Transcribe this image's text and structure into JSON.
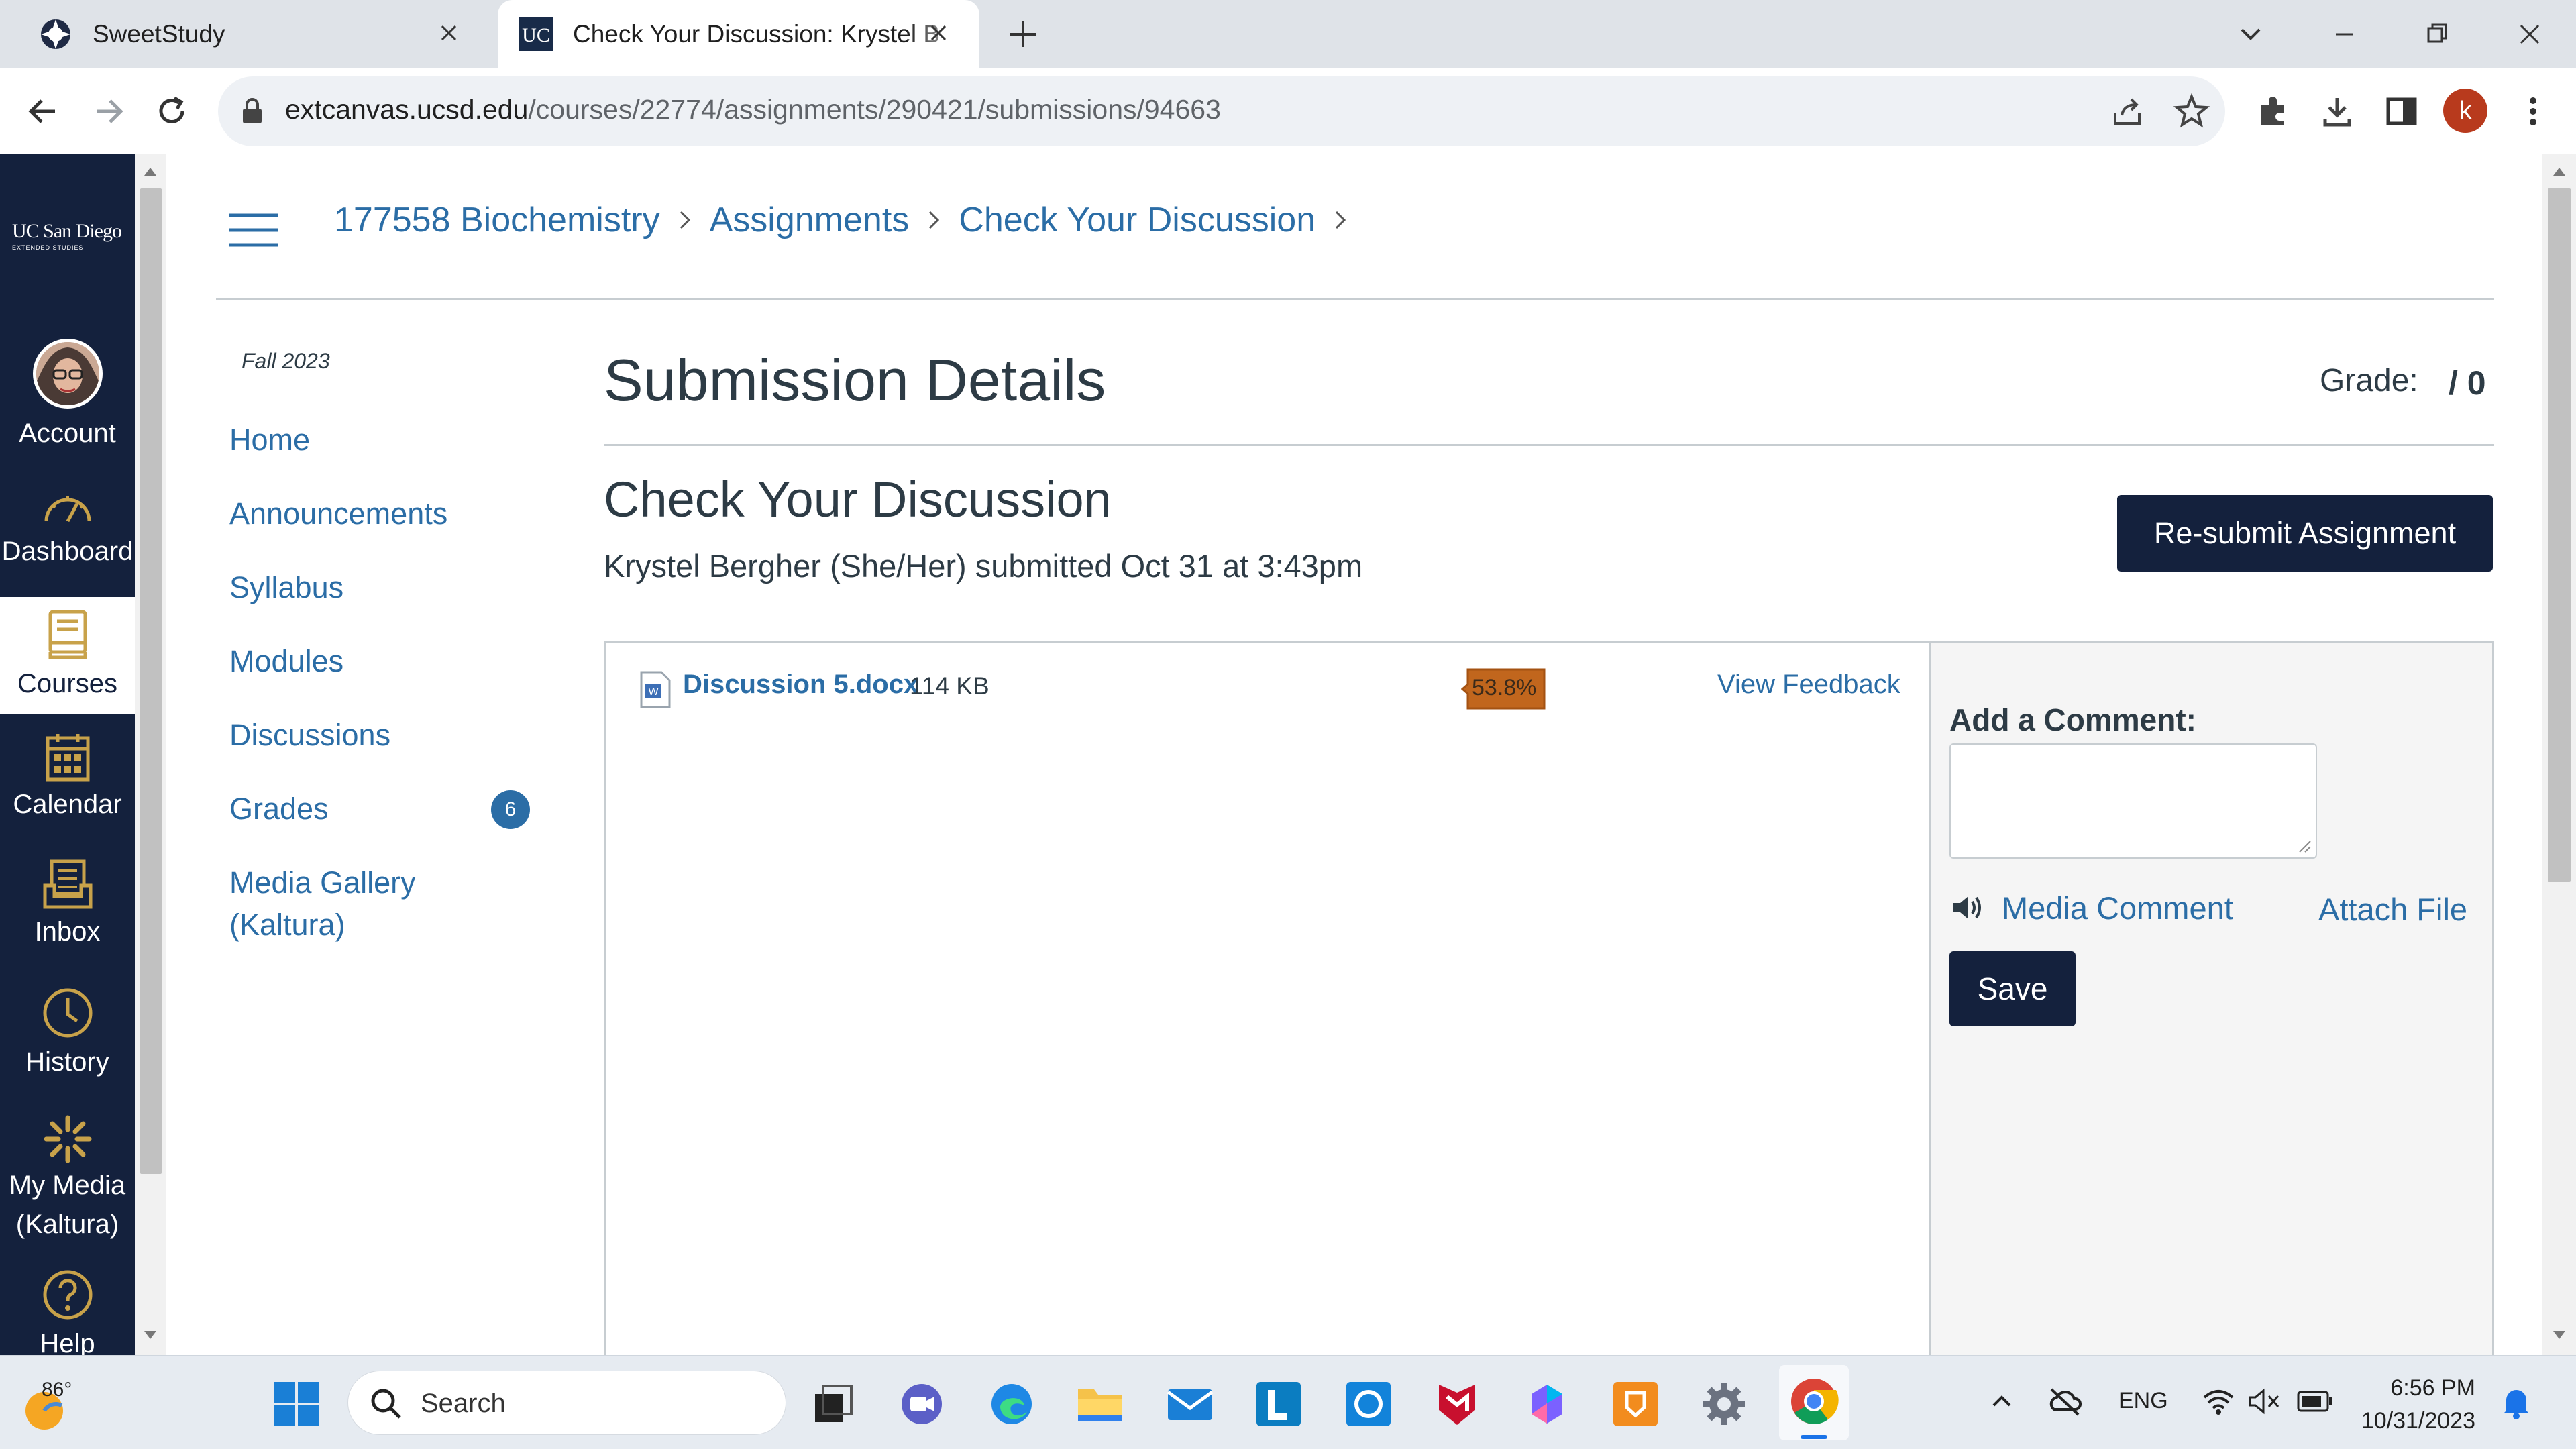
{
  "browser": {
    "tabs": [
      {
        "title": "SweetStudy",
        "active": false
      },
      {
        "title": "Check Your Discussion: Krystel B",
        "active": true
      }
    ],
    "url_host": "extcanvas.ucsd.edu",
    "url_path": "/courses/22774/assignments/290421/submissions/94663",
    "profile_initial": "k"
  },
  "global_nav": {
    "logo_line1": "UC San Diego",
    "logo_line2": "EXTENDED STUDIES",
    "items": [
      {
        "label": "Account",
        "icon": "avatar"
      },
      {
        "label": "Dashboard",
        "icon": "dashboard-icon"
      },
      {
        "label": "Courses",
        "icon": "courses-icon",
        "active": true
      },
      {
        "label": "Calendar",
        "icon": "calendar-icon"
      },
      {
        "label": "Inbox",
        "icon": "inbox-icon"
      },
      {
        "label": "History",
        "icon": "history-icon"
      },
      {
        "label": "My Media",
        "label2": "(Kaltura)",
        "icon": "kaltura-icon"
      },
      {
        "label": "Help",
        "icon": "help-icon"
      }
    ]
  },
  "breadcrumbs": [
    "177558 Biochemistry",
    "Assignments",
    "Check Your Discussion"
  ],
  "course_nav": {
    "term": "Fall 2023",
    "items": [
      {
        "label": "Home"
      },
      {
        "label": "Announcements"
      },
      {
        "label": "Syllabus"
      },
      {
        "label": "Modules"
      },
      {
        "label": "Discussions"
      },
      {
        "label": "Grades",
        "badge": "6"
      },
      {
        "label": "Media Gallery",
        "label2": "(Kaltura)"
      }
    ]
  },
  "submission": {
    "page_title": "Submission Details",
    "grade_label": "Grade:",
    "grade_value": "/ 0",
    "assignment_title": "Check Your Discussion",
    "submitted_line": "Krystel Bergher (She/Her) submitted Oct 31 at 3:43pm",
    "resubmit_label": "Re-submit Assignment",
    "file_name": "Discussion 5.docx",
    "file_size": "114 KB",
    "similarity": "53.8%",
    "view_feedback": "View Feedback"
  },
  "comment": {
    "heading": "Add a Comment:",
    "media_comment": "Media Comment",
    "attach_file": "Attach File",
    "save": "Save"
  },
  "taskbar": {
    "weather_temp": "86°",
    "search_placeholder": "Search",
    "language": "ENG",
    "time": "6:56 PM",
    "date": "10/31/2023"
  },
  "colors": {
    "nav_bg": "#14213d",
    "link": "#2b6da6",
    "similarity_bg": "#c1661d",
    "badge_bg": "#2b6da6"
  }
}
